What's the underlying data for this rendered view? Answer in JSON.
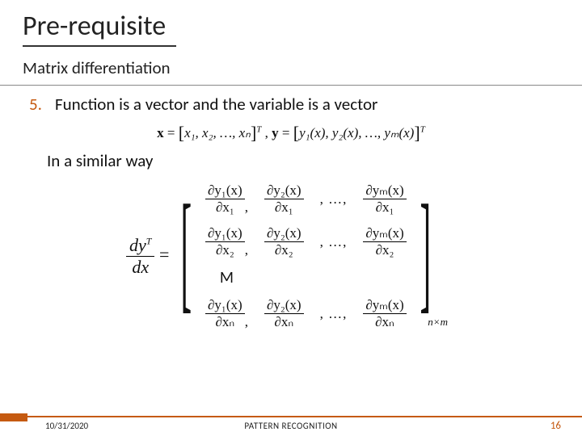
{
  "title": "Pre-requisite",
  "subtitle": "Matrix differentiation",
  "item_number": "5.",
  "item_text": "Function is a vector and the variable is a vector",
  "similar_text": "In a similar way",
  "eq1": {
    "x_lhs": "x",
    "x_open": "[",
    "x_elems": "x₁, x₂, …, xₙ",
    "x_close": "]",
    "x_sup": "T",
    "sep": " , ",
    "y_lhs": "y",
    "y_open": "[",
    "y_elems": "y₁(x), y₂(x), …, yₘ(x)",
    "y_close": "]",
    "y_sup": "T"
  },
  "lhs": {
    "num": "dy",
    "num_sup": "T",
    "den": "dx",
    "eq": "="
  },
  "jac": {
    "r1": {
      "c1n": "∂y₁(x)",
      "c1d": "∂x₁",
      "c2n": "∂y₂(x)",
      "c2d": "∂x₁",
      "dots": ", …,",
      "cmn": "∂yₘ(x)",
      "cmd": "∂x₁"
    },
    "r2": {
      "c1n": "∂y₁(x)",
      "c1d": "∂x₂",
      "c2n": "∂y₂(x)",
      "c2d": "∂x₂",
      "dots": ", …,",
      "cmn": "∂yₘ(x)",
      "cmd": "∂x₂"
    },
    "vdots": "M",
    "rn": {
      "c1n": "∂y₁(x)",
      "c1d": "∂xₙ",
      "c2n": "∂y₂(x)",
      "c2d": "∂xₙ",
      "dots": ", …,",
      "cmn": "∂yₘ(x)",
      "cmd": "∂xₙ"
    },
    "comma": ",",
    "dim": "n×m"
  },
  "footer": {
    "date": "10/31/2020",
    "label": "PATTERN RECOGNITION",
    "page": "16"
  }
}
